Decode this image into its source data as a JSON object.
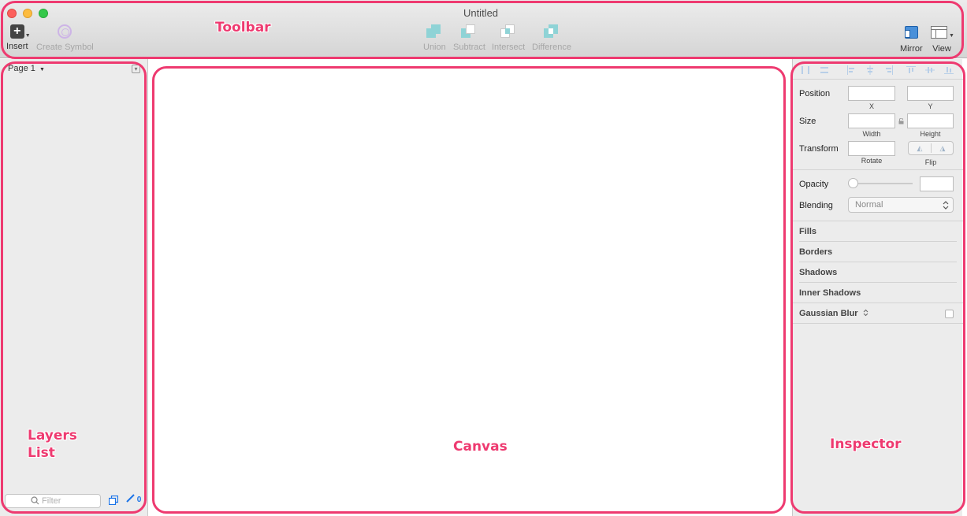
{
  "window": {
    "title": "Untitled"
  },
  "toolbar": {
    "insert_label": "Insert",
    "create_symbol_label": "Create Symbol",
    "union_label": "Union",
    "subtract_label": "Subtract",
    "intersect_label": "Intersect",
    "difference_label": "Difference",
    "mirror_label": "Mirror",
    "view_label": "View"
  },
  "layers": {
    "page_label": "Page 1",
    "filter_placeholder": "Filter",
    "badge_count": "0"
  },
  "inspector": {
    "position_label": "Position",
    "x_label": "X",
    "y_label": "Y",
    "size_label": "Size",
    "width_label": "Width",
    "height_label": "Height",
    "transform_label": "Transform",
    "rotate_label": "Rotate",
    "flip_label": "Flip",
    "opacity_label": "Opacity",
    "blending_label": "Blending",
    "blending_value": "Normal",
    "sections": [
      "Fills",
      "Borders",
      "Shadows",
      "Inner Shadows",
      "Gaussian Blur"
    ]
  },
  "annotations": {
    "toolbar": "Toolbar",
    "layers_line1": "Layers",
    "layers_line2": "List",
    "canvas": "Canvas",
    "inspector": "Inspector"
  },
  "colors": {
    "annotation": "#ee3a70",
    "bool_icon": "#7fd0d4",
    "accent": "#1a73e8"
  }
}
